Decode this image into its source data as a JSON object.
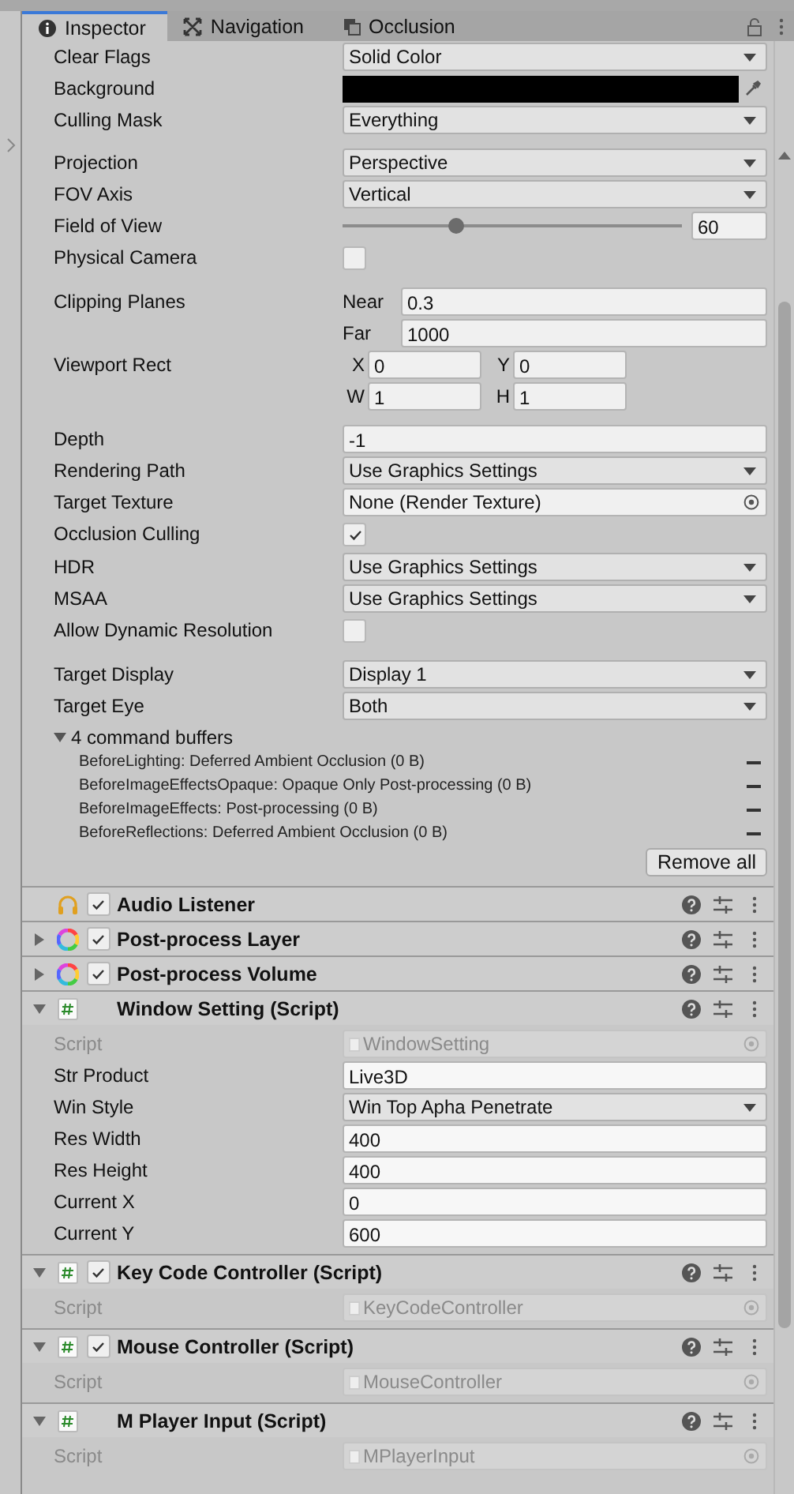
{
  "tabs": [
    {
      "label": "Inspector",
      "kind": "info",
      "selected": true
    },
    {
      "label": "Navigation",
      "kind": "navigation",
      "selected": false
    },
    {
      "label": "Occlusion",
      "kind": "occlusion",
      "selected": false
    }
  ],
  "camera_groups": [
    {
      "fields": [
        {
          "label": "Clear Flags",
          "kind": "dropdown",
          "value": "Solid Color"
        },
        {
          "label": "Background",
          "kind": "color",
          "color": "#000000"
        },
        {
          "label": "Culling Mask",
          "kind": "dropdown",
          "value": "Everything"
        }
      ]
    },
    {
      "fields": [
        {
          "label": "Projection",
          "kind": "dropdown",
          "value": "Perspective"
        },
        {
          "label": "FOV Axis",
          "kind": "dropdown",
          "value": "Vertical"
        },
        {
          "label": "Field of View",
          "kind": "slider",
          "level": 0.335,
          "value": "60"
        },
        {
          "label": "Physical Camera",
          "kind": "checkbox",
          "checked": false
        }
      ]
    },
    {
      "fields": [
        {
          "label": "Clipping Planes",
          "kind": "planes",
          "parts": [
            {
              "label": "Near",
              "value": "0.3"
            },
            {
              "label": "Far",
              "value": "1000"
            }
          ]
        },
        {
          "label": "Viewport Rect",
          "kind": "rect",
          "parts": [
            {
              "label": "X",
              "value": "0"
            },
            {
              "label": "Y",
              "value": "0"
            },
            {
              "label": "W",
              "value": "1"
            },
            {
              "label": "H",
              "value": "1"
            }
          ]
        }
      ]
    },
    {
      "fields": [
        {
          "label": "Depth",
          "kind": "text",
          "value": "-1"
        },
        {
          "label": "Rendering Path",
          "kind": "dropdown",
          "value": "Use Graphics Settings"
        },
        {
          "label": "Target Texture",
          "kind": "object",
          "value": "None (Render Texture)"
        },
        {
          "label": "Occlusion Culling",
          "kind": "checkbox",
          "checked": true
        },
        {
          "label": "HDR",
          "kind": "dropdown",
          "value": "Use Graphics Settings"
        },
        {
          "label": "MSAA",
          "kind": "dropdown",
          "value": "Use Graphics Settings"
        },
        {
          "label": "Allow Dynamic Resolution",
          "kind": "checkbox",
          "checked": false
        }
      ]
    },
    {
      "fields": [
        {
          "label": "Target Display",
          "kind": "dropdown",
          "value": "Display 1"
        },
        {
          "label": "Target Eye",
          "kind": "dropdown",
          "value": "Both"
        }
      ]
    }
  ],
  "command_buffers": {
    "label": "4 command buffers",
    "expanded": true,
    "button": "Remove all",
    "items": [
      "BeforeLighting: Deferred Ambient Occlusion (0 B)",
      "BeforeImageEffectsOpaque: Opaque Only Post-processing (0 B)",
      "BeforeImageEffects: Post-processing (0 B)",
      "BeforeReflections: Deferred Ambient Occlusion (0 B)"
    ]
  },
  "components": [
    {
      "name": "Audio Listener",
      "kind": "headphones",
      "enabled": true
    },
    {
      "name": "Post-process Layer",
      "kind": "color-wheel",
      "expanded": false,
      "enabled": true
    },
    {
      "name": "Post-process Volume",
      "kind": "color-wheel",
      "expanded": false,
      "enabled": true
    },
    {
      "name": "Window Setting (Script)",
      "kind": "script",
      "expanded": true,
      "fields": [
        {
          "label": "Script",
          "kind": "script",
          "value": "WindowSetting",
          "disabled": true
        },
        {
          "label": "Str Product",
          "kind": "text",
          "value": "Live3D"
        },
        {
          "label": "Win Style",
          "kind": "dropdown",
          "value": "Win Top Apha Penetrate"
        },
        {
          "label": "Res Width",
          "kind": "text",
          "value": "400"
        },
        {
          "label": "Res Height",
          "kind": "text",
          "value": "400"
        },
        {
          "label": "Current X",
          "kind": "text",
          "value": "0"
        },
        {
          "label": "Current Y",
          "kind": "text",
          "value": "600"
        }
      ]
    },
    {
      "name": "Key Code Controller (Script)",
      "kind": "script",
      "expanded": true,
      "enabled": true,
      "fields": [
        {
          "label": "Script",
          "kind": "script",
          "value": "KeyCodeController",
          "disabled": true
        }
      ]
    },
    {
      "name": "Mouse Controller (Script)",
      "kind": "script",
      "expanded": true,
      "enabled": true,
      "fields": [
        {
          "label": "Script",
          "kind": "script",
          "value": "MouseController",
          "disabled": true
        }
      ]
    },
    {
      "name": "M Player Input (Script)",
      "kind": "script",
      "expanded": true,
      "fields": [
        {
          "label": "Script",
          "kind": "script",
          "value": "MPlayerInput",
          "disabled": true
        }
      ]
    }
  ]
}
